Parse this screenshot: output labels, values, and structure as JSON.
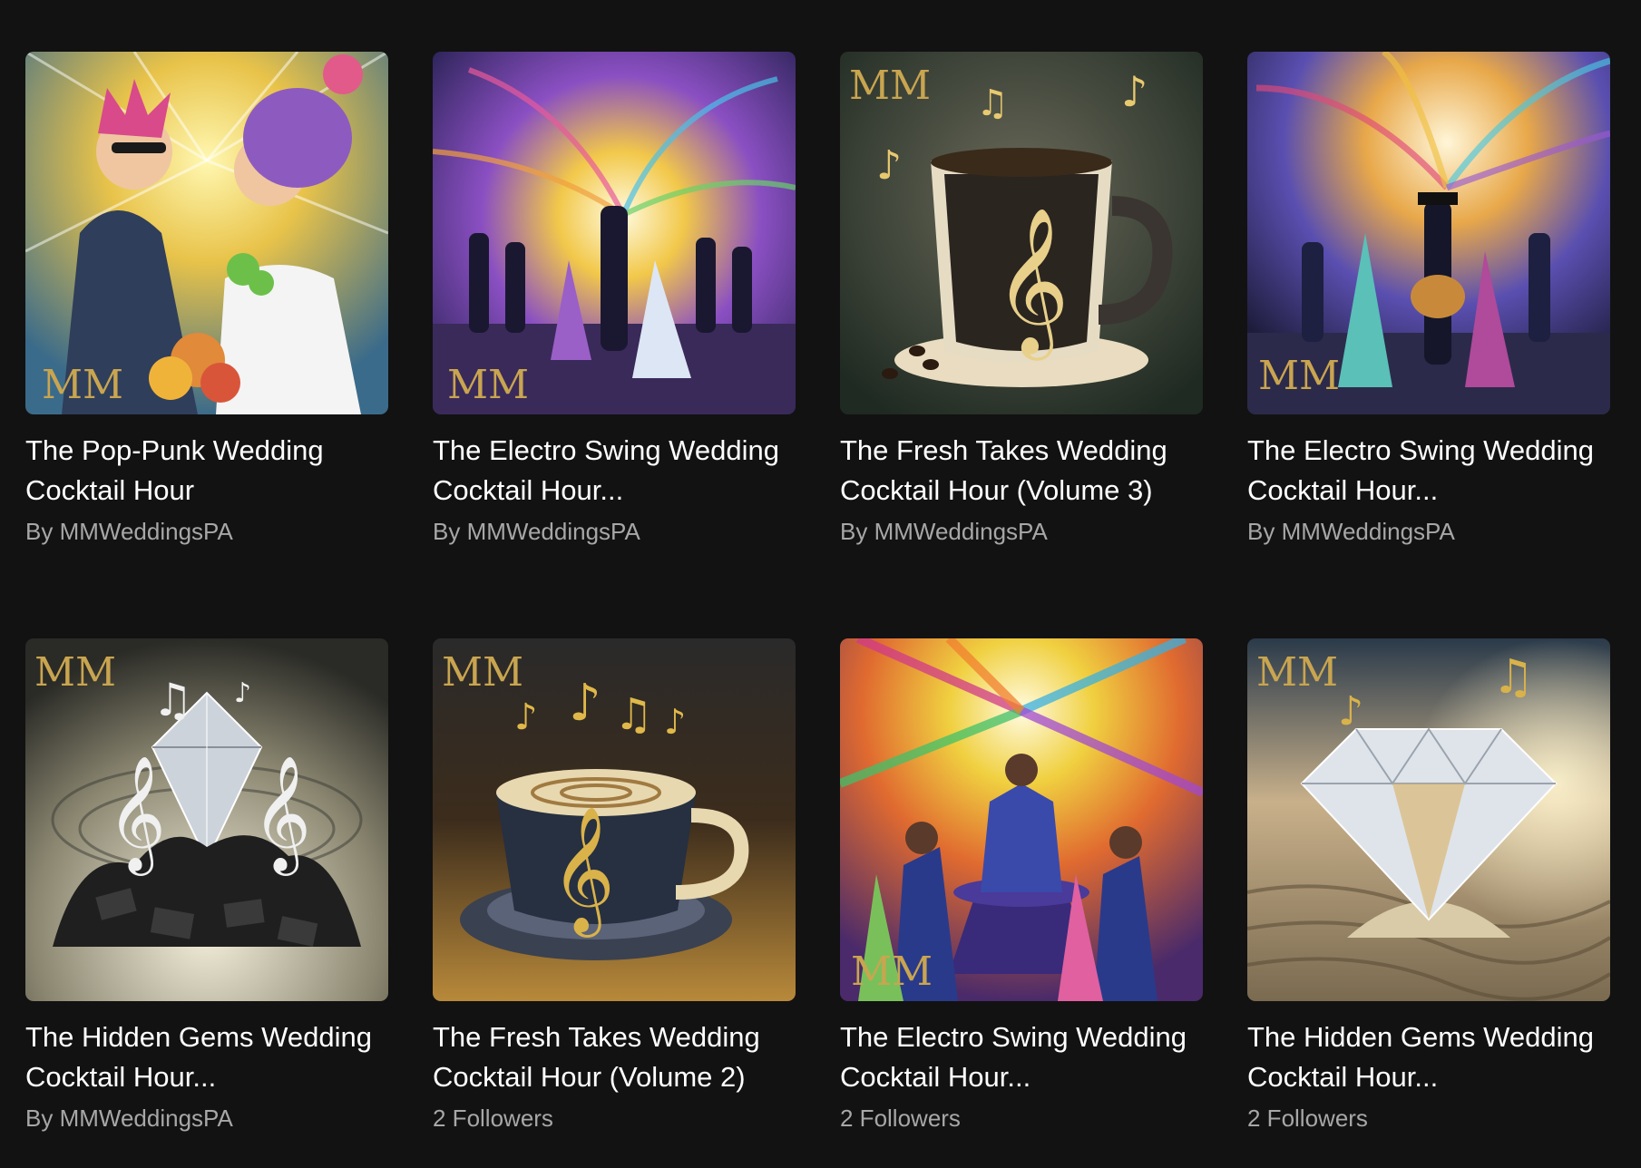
{
  "playlists": [
    {
      "title": "The Pop-Punk Wedding Cocktail Hour",
      "subtitle": "By MMWeddingsPA",
      "art": "couple-popart"
    },
    {
      "title": "The Electro Swing Wedding Cocktail Hour...",
      "subtitle": "By MMWeddingsPA",
      "art": "swing-band-burst"
    },
    {
      "title": "The Fresh Takes Wedding Cocktail Hour (Volume 3)",
      "subtitle": "By MMWeddingsPA",
      "art": "coffee-mug-music"
    },
    {
      "title": "The Electro Swing Wedding Cocktail Hour...",
      "subtitle": "By MMWeddingsPA",
      "art": "swing-band-stage"
    },
    {
      "title": "The Hidden Gems Wedding Cocktail Hour...",
      "subtitle": "By MMWeddingsPA",
      "art": "diamond-coal"
    },
    {
      "title": "The Fresh Takes Wedding Cocktail Hour (Volume 2)",
      "subtitle": "2 Followers",
      "art": "coffee-cup-notes"
    },
    {
      "title": "The Electro Swing Wedding Cocktail Hour...",
      "subtitle": "2 Followers",
      "art": "swing-band-colorful"
    },
    {
      "title": "The Hidden Gems Wedding Cocktail Hour...",
      "subtitle": "2 Followers",
      "art": "diamond-sand"
    }
  ],
  "logo_mark": "MM",
  "colors": {
    "background": "#121212",
    "title": "#ffffff",
    "subtitle": "#a7a7a7",
    "gold": "#c9a550"
  }
}
